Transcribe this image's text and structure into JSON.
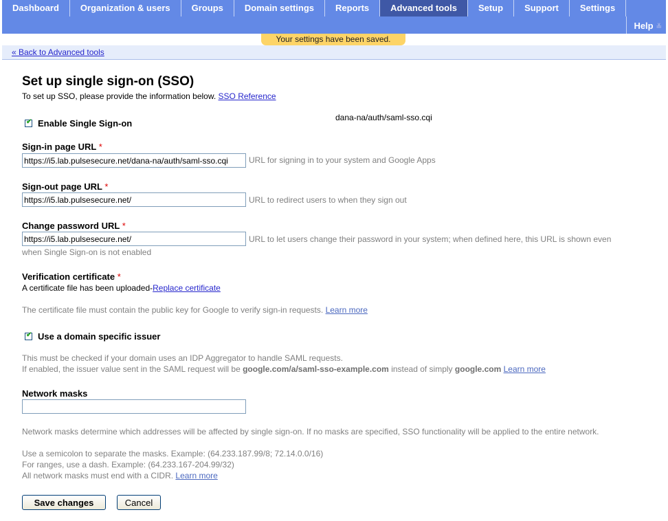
{
  "nav": {
    "tabs": [
      {
        "label": "Dashboard",
        "active": false
      },
      {
        "label": "Organization & users",
        "active": false
      },
      {
        "label": "Groups",
        "active": false
      },
      {
        "label": "Domain settings",
        "active": false
      },
      {
        "label": "Reports",
        "active": false
      },
      {
        "label": "Advanced tools",
        "active": true
      },
      {
        "label": "Setup",
        "active": false
      },
      {
        "label": "Support",
        "active": false
      },
      {
        "label": "Settings",
        "active": false
      }
    ],
    "help_label": "Help",
    "help_icon": "double-chevron-down-icon"
  },
  "notice": "Your settings have been saved.",
  "back_link": "« Back to Advanced tools",
  "page": {
    "title": "Set up single sign-on (SSO)",
    "intro": "To set up SSO, please provide the information below.",
    "intro_link": "SSO Reference",
    "floating_text": "dana-na/auth/saml-sso.cqi",
    "enable_sso": {
      "label": "Enable Single Sign-on",
      "checked": true
    },
    "signin": {
      "label": "Sign-in page URL",
      "required": "*",
      "value": "https://i5.lab.pulsesecure.net/dana-na/auth/saml-sso.cqi",
      "hint": "URL for signing in to your system and Google Apps"
    },
    "signout": {
      "label": "Sign-out page URL",
      "required": "*",
      "value": "https://i5.lab.pulsesecure.net/",
      "hint": "URL to redirect users to when they sign out"
    },
    "change_password": {
      "label": "Change password URL",
      "required": "*",
      "value": "https://i5.lab.pulsesecure.net/",
      "hint": "URL to let users change their password in your system; when defined here, this URL is shown even",
      "hint_cont": "when Single Sign-on is not enabled"
    },
    "certificate": {
      "label": "Verification certificate",
      "required": "*",
      "status": "A certificate file has been uploaded-",
      "replace_link": "Replace certificate",
      "note": "The certificate file must contain the public key for Google to verify sign-in requests.",
      "learn_more": "Learn more"
    },
    "domain_issuer": {
      "label": "Use a domain specific issuer",
      "checked": true,
      "line1": "This must be checked if your domain uses an IDP Aggregator to handle SAML requests.",
      "line2_pre": "If enabled, the issuer value sent in the SAML request will be",
      "line2_bold1": "google.com/a/saml-sso-example.com",
      "line2_mid": "instead of simply",
      "line2_bold2": "google.com",
      "learn_more": "Learn more"
    },
    "network_masks": {
      "label": "Network masks",
      "value": "",
      "help1": "Network masks determine which addresses will be affected by single sign-on. If no masks are specified, SSO functionality will be applied to the entire network.",
      "help2": "Use a semicolon to separate the masks. Example: (64.233.187.99/8; 72.14.0.0/16)",
      "help3": "For ranges, use a dash. Example: (64.233.167-204.99/32)",
      "help4": "All network masks must end with a CIDR.",
      "learn_more": "Learn more"
    },
    "buttons": {
      "save": "Save changes",
      "cancel": "Cancel"
    }
  }
}
